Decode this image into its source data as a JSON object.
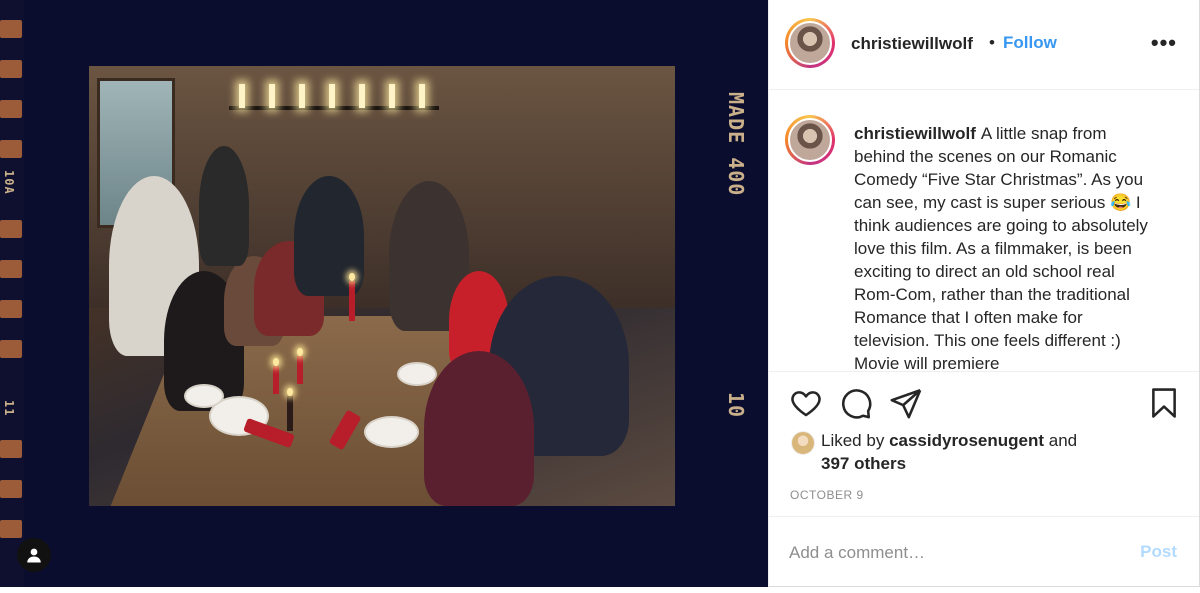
{
  "media": {
    "film_markings": {
      "made": "MADE 400",
      "frame_number": "10",
      "left_top": "10A",
      "left_bottom": "11"
    },
    "user_tag_icon": "person-icon"
  },
  "post": {
    "author": "christiewillwolf",
    "separator": "•",
    "follow_label": "Follow",
    "more_icon": "more-options-icon",
    "more_label": "•••",
    "caption_text": "A little snap from behind the scenes on our Romanic Comedy “Five Star Christmas”. As you can see, my cast is super serious 😂 I think audiences are going to absolutely love this film. As a filmmaker, is been exciting to direct an old school real Rom-Com, rather than the traditional Romance that I often make for television. This one feels different :) Movie will premiere",
    "likes": {
      "prefix": "Liked by",
      "user": "cassidyrosenugent",
      "joiner": "and",
      "others": "397 others"
    },
    "date": "OCTOBER 9"
  },
  "actions": {
    "like_icon": "heart-icon",
    "comment_icon": "comment-bubble-icon",
    "share_icon": "paper-plane-icon",
    "save_icon": "bookmark-icon"
  },
  "comment": {
    "placeholder": "Add a comment…",
    "post_label": "Post"
  },
  "colors": {
    "accent": "#3897f0",
    "post_disabled": "#b3dbff",
    "muted": "#8e8e8e",
    "text": "#262626"
  }
}
